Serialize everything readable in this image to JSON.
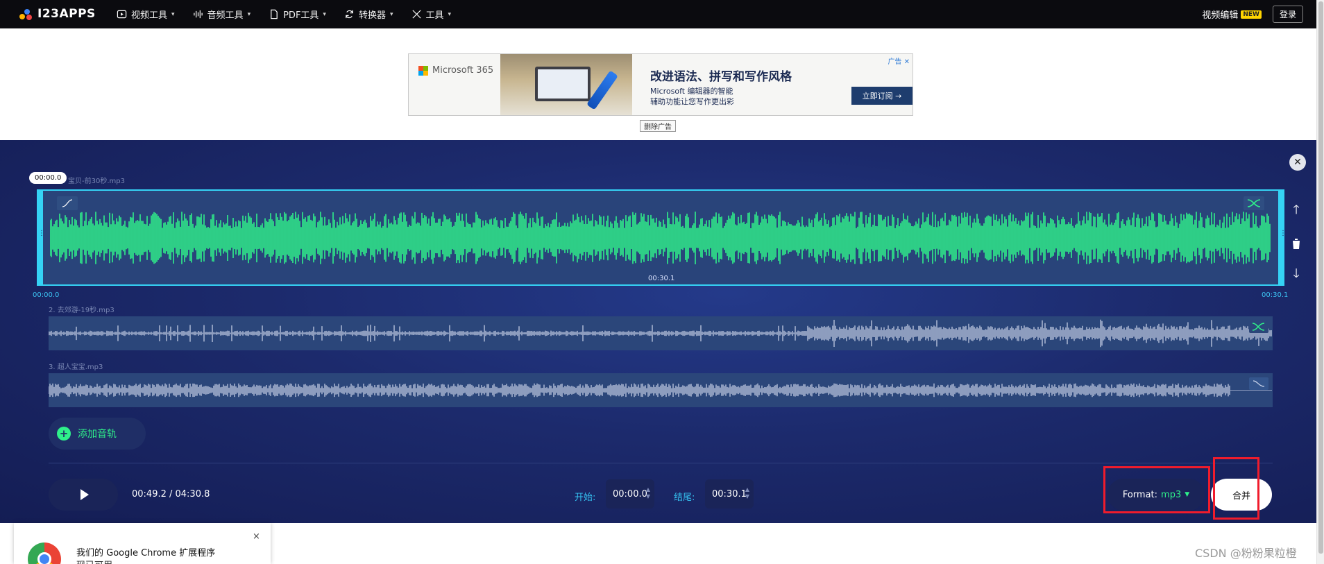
{
  "header": {
    "logo_text": "I23APPS",
    "nav": [
      {
        "label": "视频工具",
        "icon": "play-square-icon"
      },
      {
        "label": "音频工具",
        "icon": "audio-wave-icon"
      },
      {
        "label": "PDF工具",
        "icon": "document-icon"
      },
      {
        "label": "转换器",
        "icon": "convert-icon"
      },
      {
        "label": "工具",
        "icon": "tools-icon"
      }
    ],
    "video_edit_label": "视频编辑",
    "new_badge": "NEW",
    "login_label": "登录"
  },
  "ad": {
    "brand": "Microsoft 365",
    "headline": "改进语法、拼写和写作风格",
    "subline_1": "Microsoft 编辑器的智能",
    "subline_2": "辅助功能让您写作更出彩",
    "cta": "立即订阅 →",
    "ad_label": "广告 ✕",
    "remove_ad": "删除广告"
  },
  "editor": {
    "playhead_time": "00:00.0",
    "tracks": [
      {
        "name": "宝贝-前30秒.mp3",
        "center_time": "00:30.1",
        "start": "00:00.0",
        "end": "00:30.1"
      },
      {
        "name": "2. 去郊游-19秒.mp3"
      },
      {
        "name": "3. 超人宝宝.mp3"
      }
    ],
    "add_track_label": "添加音轨",
    "playback_time": "00:49.2 / 04:30.8",
    "start_label": "开始:",
    "start_value": "00:00.0",
    "end_label": "结尾:",
    "end_value": "00:30.1",
    "format_label": "Format:",
    "format_value": "mp3",
    "merge_label": "合并",
    "colors": {
      "accent": "#35d3f5",
      "wave": "#2ff08a",
      "wave_muted": "#a6b3cf",
      "highlight": "#f01c2c"
    }
  },
  "popup": {
    "title": "我们的 Google Chrome 扩展程序",
    "subtitle": "现已可用",
    "close": "×"
  },
  "watermark": "CSDN @粉粉果粒橙"
}
